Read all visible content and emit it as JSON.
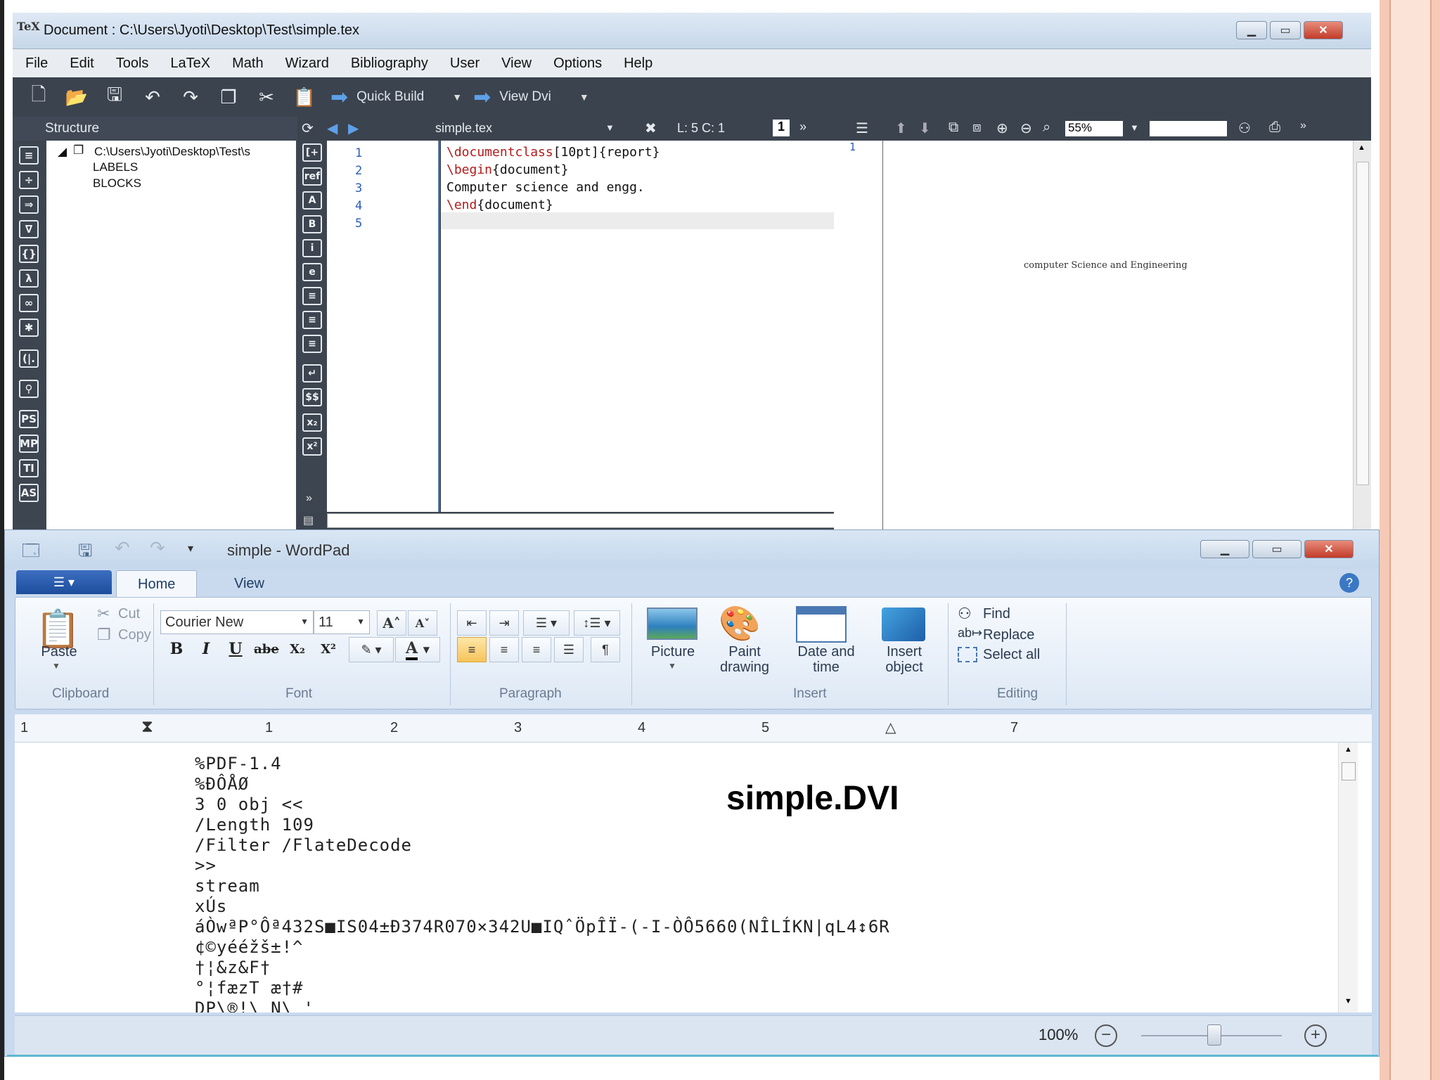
{
  "texmaker": {
    "logo": "TeX",
    "title": "Document : C:\\Users\\Jyoti\\Desktop\\Test\\simple.tex",
    "menu": [
      "File",
      "Edit",
      "Tools",
      "LaTeX",
      "Math",
      "Wizard",
      "Bibliography",
      "User",
      "View",
      "Options",
      "Help"
    ],
    "toolbar": {
      "quick_build": "Quick Build",
      "view": "View Dvi"
    },
    "structure": {
      "header": "Structure",
      "root": "C:\\Users\\Jyoti\\Desktop\\Test\\s",
      "items": [
        "LABELS",
        "BLOCKS"
      ],
      "side_icons": [
        "≡",
        "÷",
        "⇒",
        "∇",
        "{}",
        "λ",
        "∞",
        "✱",
        "(|.",
        "⚲",
        "PS",
        "MP",
        "TI",
        "AS"
      ]
    },
    "editor": {
      "filename": "simple.tex",
      "position": "L: 5 C: 1",
      "line_numbers": [
        "1",
        "2",
        "3",
        "4",
        "5"
      ],
      "lines": [
        {
          "cmd": "\\documentclass",
          "rest": "[10pt]{report}"
        },
        {
          "cmd": "\\begin",
          "rest": "{document}"
        },
        {
          "cmd": "",
          "rest": "Computer science and engg."
        },
        {
          "cmd": "\\end",
          "rest": "{document}"
        }
      ],
      "side_icons": [
        "[+",
        "ref",
        "A",
        "B",
        "i",
        "e",
        "≡",
        "≡",
        "≡",
        "↵",
        "$$",
        "x₂",
        "x²",
        "»"
      ]
    },
    "viewer": {
      "zoom": "55%",
      "page_num": "1",
      "page_text": "computer Science and Engineering"
    }
  },
  "wordpad": {
    "title": "simple - WordPad",
    "tabs": [
      "Home",
      "View"
    ],
    "clipboard": {
      "paste": "Paste",
      "cut": "Cut",
      "copy": "Copy",
      "label": "Clipboard"
    },
    "font": {
      "family": "Courier New",
      "size": "11",
      "label": "Font",
      "buttons": [
        "B",
        "I",
        "U",
        "abe",
        "X₂",
        "X²"
      ]
    },
    "paragraph": {
      "label": "Paragraph"
    },
    "insert": {
      "picture": "Picture",
      "paint": "Paint drawing",
      "datetime": "Date and time",
      "object": "Insert object",
      "label": "Insert"
    },
    "editing": {
      "find": "Find",
      "replace": "Replace",
      "select_all": "Select all",
      "label": "Editing"
    },
    "ruler": [
      "1",
      "1",
      "2",
      "3",
      "4",
      "5",
      "7"
    ],
    "document_lines": [
      "%PDF-1.4",
      "%ÐÔÅØ",
      "3 0 obj <<",
      "/Length 109",
      "/Filter /FlateDecode",
      ">>",
      "stream",
      "xÚs",
      "áÒwªP°Ôª432S■IS04±Ð374R070×342U■IQˆÖpÎÏ-(-I-ÒÔ5660(NÎLÍKN|qL4↕6R",
      "¢©yééžš±!^",
      "†¦&z&F†",
      "°¦fæzT æ†#",
      "DP\\®!\\ N\\ '"
    ],
    "overlay_label": "simple.DVI",
    "zoom": "100%"
  }
}
